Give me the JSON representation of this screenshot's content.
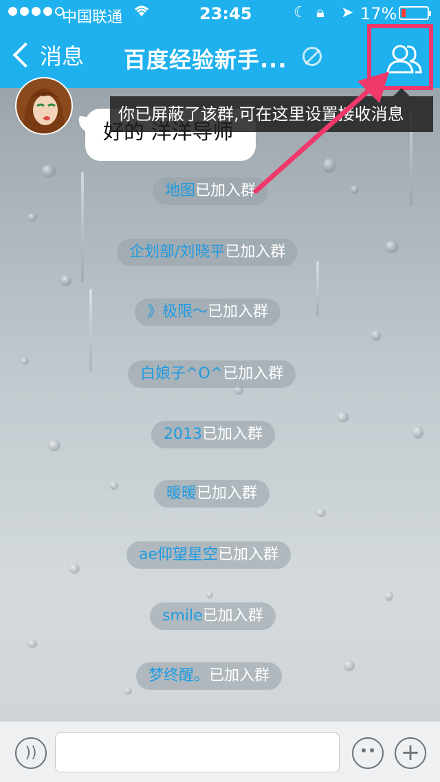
{
  "status_bar": {
    "carrier": "中国联通",
    "time": "23:45",
    "battery": "17%"
  },
  "nav": {
    "back_label": "消息",
    "title": "百度经验新手..."
  },
  "tooltip": "你已屏蔽了该群,可在这里设置接收消息",
  "message": {
    "text": "好的 洋洋导师"
  },
  "system_messages": [
    {
      "who": "地图",
      "action": "已加入群"
    },
    {
      "who": "企划部/刘晓平",
      "action": "已加入群"
    },
    {
      "who": "》极限～",
      "action": "已加入群"
    },
    {
      "who": "白娘子^O^",
      "action": "已加入群"
    },
    {
      "who": "2013",
      "action": "已加入群"
    },
    {
      "who": "暖暖",
      "action": "已加入群"
    },
    {
      "who": "ae仰望星空",
      "action": "已加入群"
    },
    {
      "who": "smile",
      "action": "已加入群"
    },
    {
      "who": "梦终醒。",
      "action": "已加入群"
    }
  ],
  "colors": {
    "nav_bar": "#1fb1ee",
    "highlight": "#f0386b",
    "member_name": "#1f9be0"
  },
  "icons": [
    "chevron-left-icon",
    "mute-icon",
    "group-members-icon",
    "voice-icon",
    "emoji-icon",
    "plus-icon"
  ]
}
